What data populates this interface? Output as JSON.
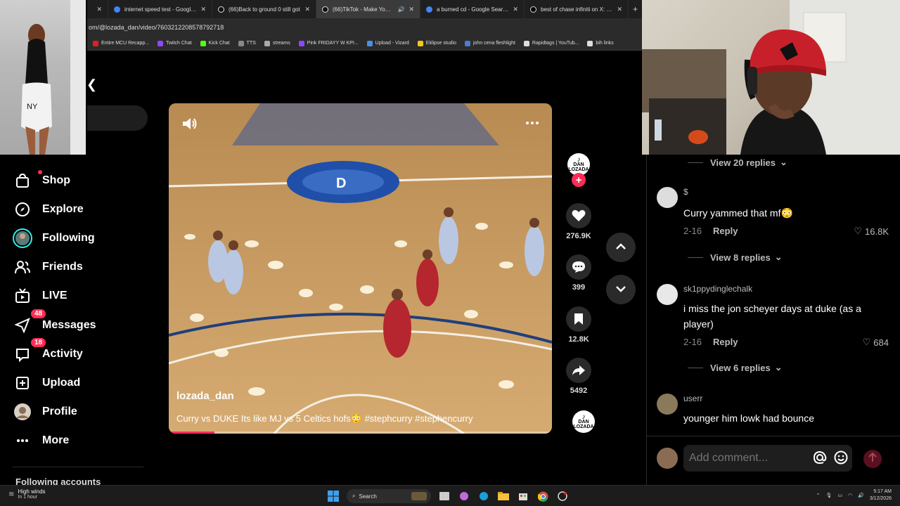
{
  "browser": {
    "tabs": [
      {
        "title": "internet speed test - Google Se",
        "active": false
      },
      {
        "title": "(66)Back to ground 0 still got",
        "active": false
      },
      {
        "title": "(66)TikTok - Make Your Day",
        "active": true
      },
      {
        "title": "a burned cd - Google Search",
        "active": false
      },
      {
        "title": "best of chase infiniti on X: \"cha",
        "active": false
      }
    ],
    "url": "om/@lozada_dan/video/7603212208578792718",
    "bookmarks": [
      "Entire MCU Recapp...",
      "Twitch Chat",
      "Kick Chat",
      "TTS",
      "streams",
      "Pink FRIDAYY W KPI...",
      "Upload - Vizard",
      "Eklipse studio",
      "john cena fleshlight",
      "Rapidtags | YouTub...",
      "bih links"
    ],
    "bookmark_colors": [
      "#e02020",
      "#9146ff",
      "#53fc18",
      "#888888",
      "#aaaaaa",
      "#9146ff",
      "#4a90e2",
      "#f5c518",
      "#4a7bd0",
      "#dddddd",
      "#dddddd"
    ]
  },
  "sidebar": {
    "items": [
      {
        "label": "Shop",
        "icon": "shopping-bag-icon"
      },
      {
        "label": "Explore",
        "icon": "compass-icon"
      },
      {
        "label": "Following",
        "icon": "avatar-ring-icon"
      },
      {
        "label": "Friends",
        "icon": "friends-icon"
      },
      {
        "label": "LIVE",
        "icon": "live-tv-icon"
      },
      {
        "label": "Messages",
        "icon": "send-icon",
        "badge": "48"
      },
      {
        "label": "Activity",
        "icon": "inbox-icon",
        "badge": "18"
      },
      {
        "label": "Upload",
        "icon": "plus-square-icon"
      },
      {
        "label": "Profile",
        "icon": "profile-avatar-icon"
      },
      {
        "label": "More",
        "icon": "ellipsis-icon"
      }
    ],
    "following_accounts": "Following accounts"
  },
  "video": {
    "username": "lozada_dan",
    "caption": "Curry vs DUKE Its like MJ vs 5 Celtics hofs😳 #stephcurry #stephencurry",
    "progress": 0.12
  },
  "actions": {
    "creator_badge": [
      "DAN",
      "LOZADA"
    ],
    "likes": "276.9K",
    "comments": "399",
    "saves": "12.8K",
    "shares": "5492"
  },
  "comments": {
    "top_view_replies": "View 20 replies",
    "items": [
      {
        "user": "$",
        "text": "Curry yammed that mf😳",
        "date": "2-16",
        "reply": "Reply",
        "likes": "16.8K",
        "view_replies": "View 8 replies"
      },
      {
        "user": "sk1ppydinglechalk",
        "text": "i miss the jon scheyer days at duke (as a player)",
        "date": "2-16",
        "reply": "Reply",
        "likes": "684",
        "view_replies": "View 6 replies"
      },
      {
        "user": "userr",
        "text": "younger him lowk had bounce",
        "date": "",
        "reply": "",
        "likes": "",
        "view_replies": ""
      }
    ],
    "input_placeholder": "Add comment..."
  },
  "taskbar": {
    "weather_title": "High winds",
    "weather_sub": "In 1 hour",
    "search_label": "Search",
    "time": "5:17 AM",
    "date": "3/12/2026"
  }
}
